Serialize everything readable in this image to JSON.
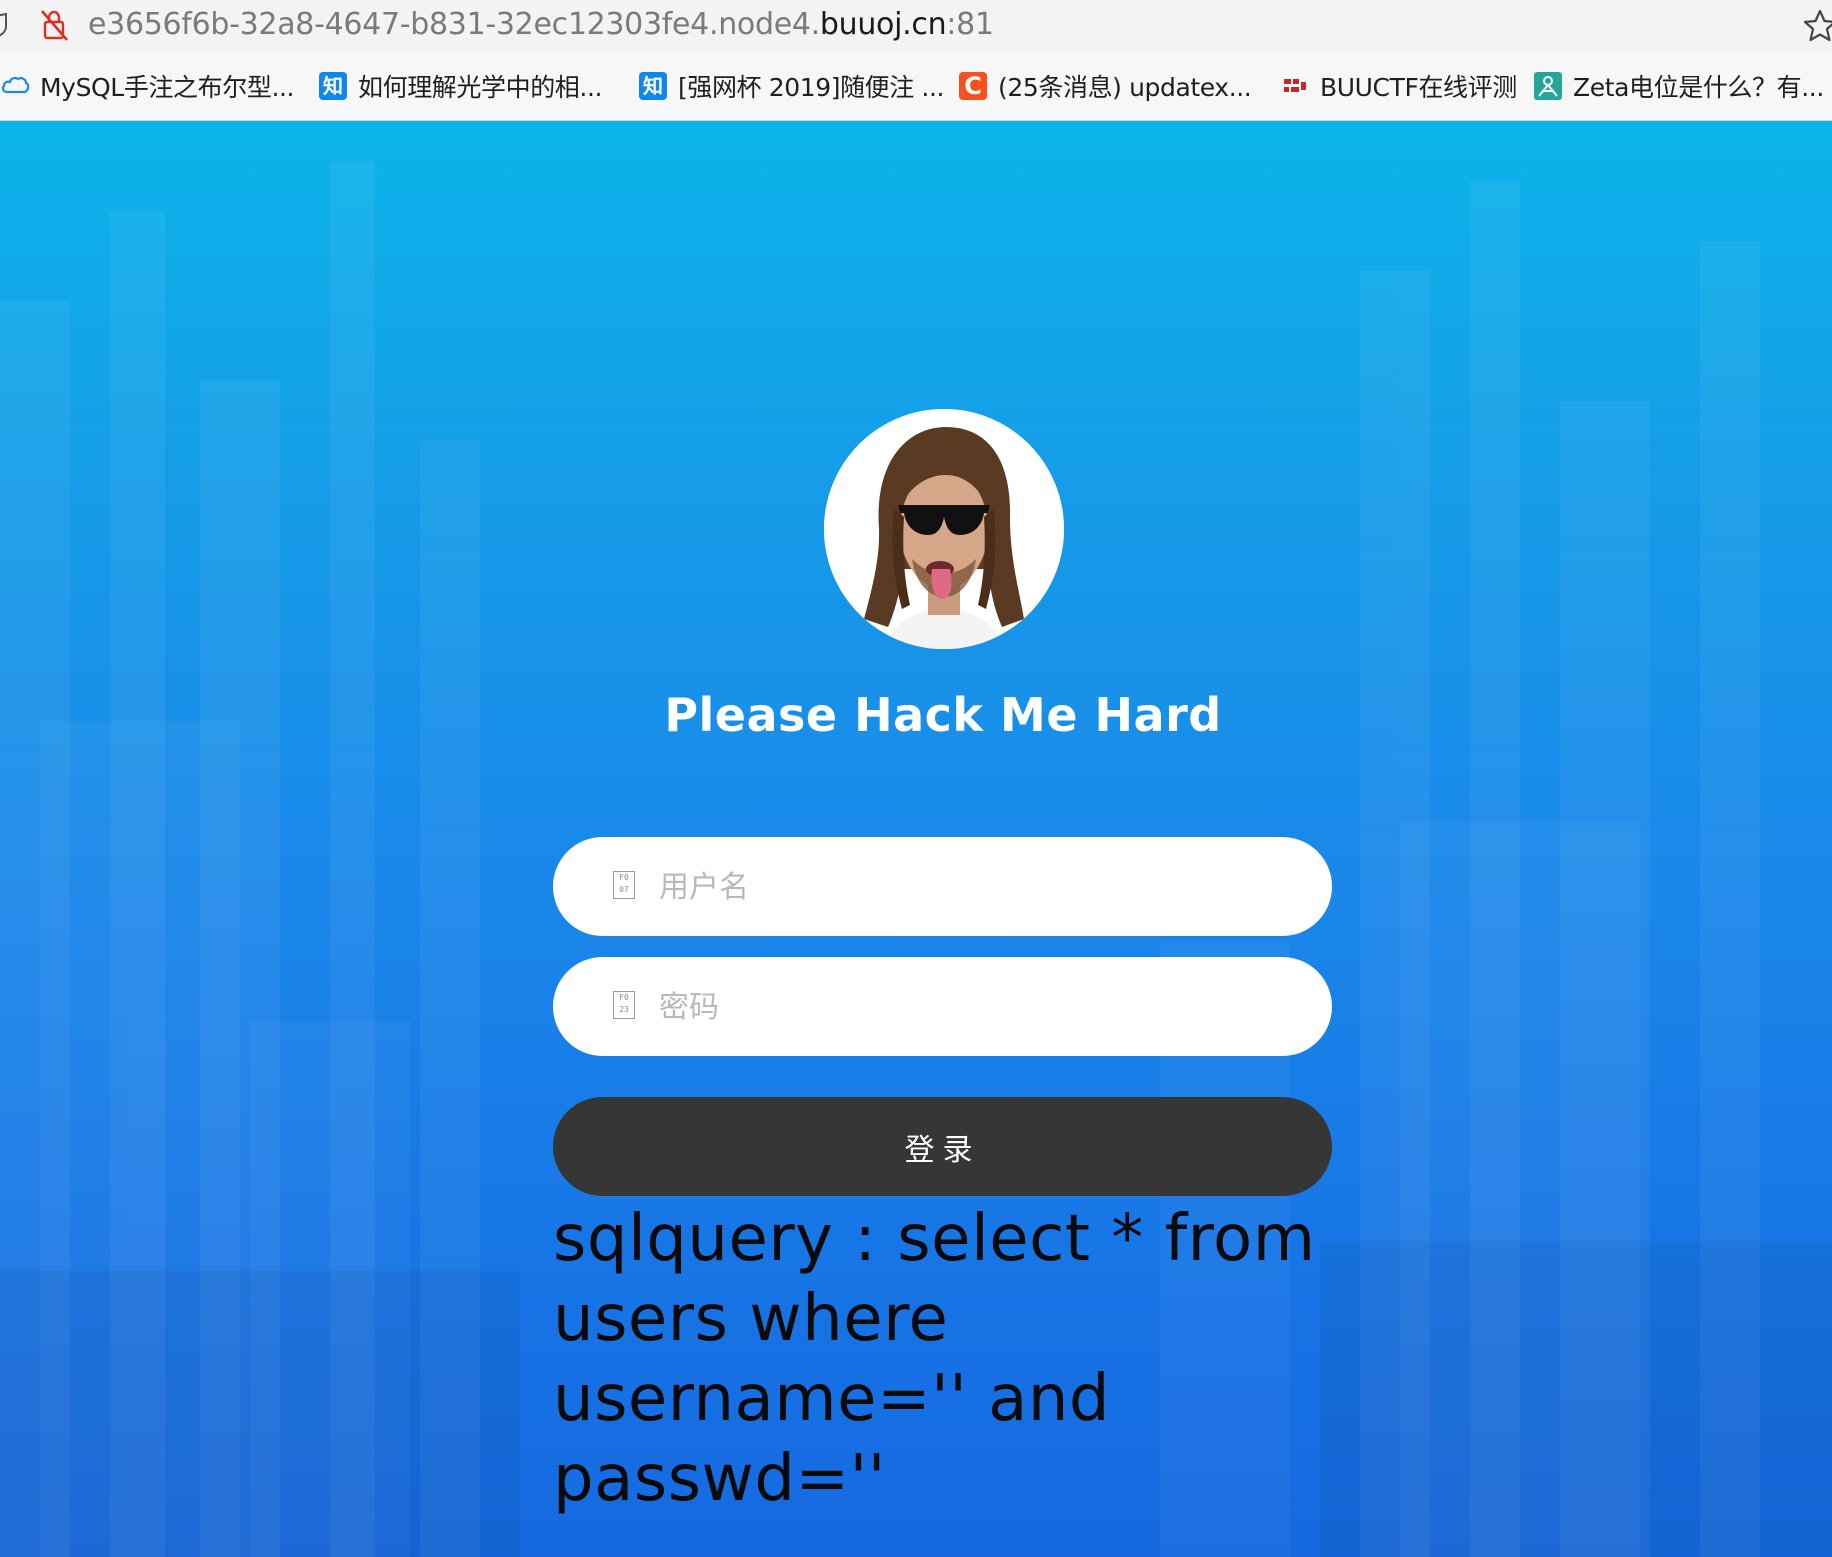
{
  "browser": {
    "url_prefix": "e3656f6b-32a8-4647-b831-32ec12303fe4.node4.",
    "url_domain": "buuoj.cn",
    "url_port": ":81"
  },
  "bookmarks": [
    {
      "label": "MySQL手注之布尔型...",
      "icon": "cloud-icon"
    },
    {
      "label": "如何理解光学中的相...",
      "icon": "zhihu-icon",
      "glyph": "知"
    },
    {
      "label": "[强网杯 2019]随便注 ...",
      "icon": "zhihu-icon",
      "glyph": "知"
    },
    {
      "label": "(25条消息) updatex...",
      "icon": "csdn-icon",
      "glyph": "C"
    },
    {
      "label": "BUUCTF在线评测",
      "icon": "buuctf-icon"
    },
    {
      "label": "Zeta电位是什么？有...",
      "icon": "zeta-icon"
    }
  ],
  "page": {
    "title": "Please Hack Me Hard",
    "username_placeholder": "用户名",
    "password_placeholder": "密码",
    "username_icon_text": "F0 07",
    "password_icon_text": "F0 23",
    "login_label": "登录",
    "sql_query": "sqlquery : select * from\nusers where\nusername='' and\npasswd=''"
  },
  "colors": {
    "background_top": "#0cb4ea",
    "background_bottom": "#1669e0",
    "button": "#363636",
    "title": "#ffffff"
  }
}
